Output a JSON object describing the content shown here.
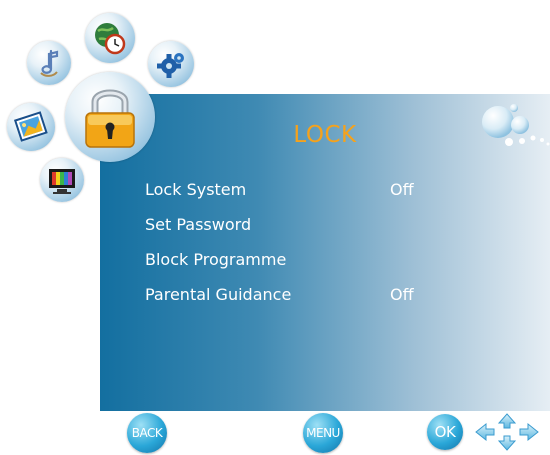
{
  "screen": {
    "title": "LOCK"
  },
  "menu_items": [
    {
      "label": "Lock System",
      "value": "Off"
    },
    {
      "label": "Set Password",
      "value": ""
    },
    {
      "label": "Block Programme",
      "value": ""
    },
    {
      "label": "Parental Guidance",
      "value": "Off"
    }
  ],
  "footer": {
    "back_label": "BACK",
    "menu_label": "MENU",
    "ok_label": "OK"
  },
  "icons": [
    "music-note-icon",
    "globe-clock-icon",
    "gear-icon",
    "picture-icon",
    "lock-icon",
    "tv-icon",
    "bubbles-icon",
    "arrow-keys-icon"
  ],
  "colors": {
    "title": "#f5a21c",
    "panel_left": "#136fa0",
    "panel_right": "#e6eef4",
    "text": "#ffffff"
  }
}
